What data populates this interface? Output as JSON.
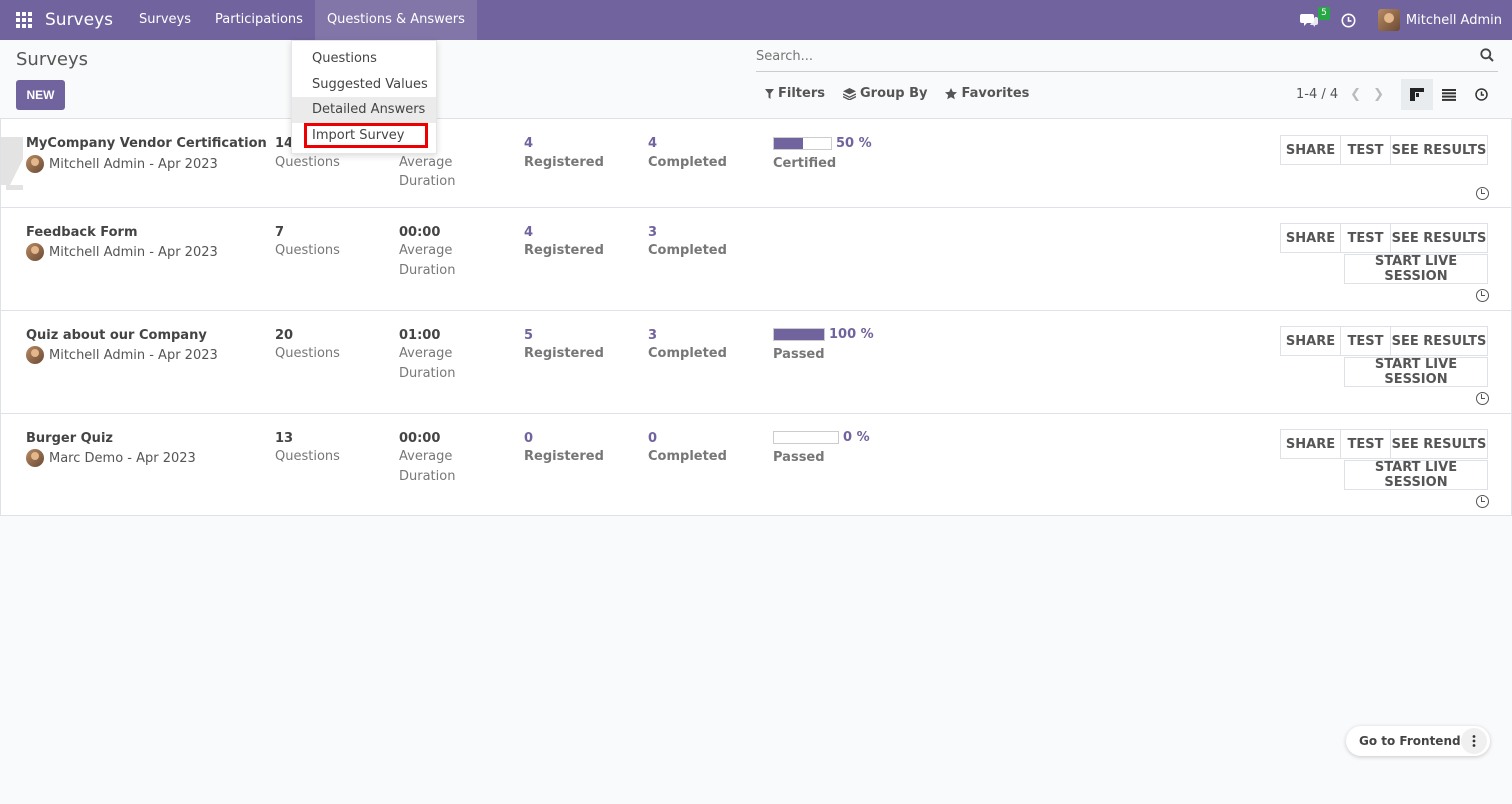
{
  "navbar": {
    "brand": "Surveys",
    "menu": [
      "Surveys",
      "Participations",
      "Questions & Answers"
    ],
    "messages_count": "5",
    "user_name": "Mitchell Admin",
    "color": "#71639e"
  },
  "dropdown": {
    "items": [
      "Questions",
      "Suggested Values",
      "Detailed Answers",
      "Import Survey"
    ]
  },
  "control": {
    "title": "Surveys",
    "new_label": "NEW",
    "search_placeholder": "Search...",
    "filters_label": "Filters",
    "groupby_label": "Group By",
    "favorites_label": "Favorites",
    "pager": "1-4 / 4"
  },
  "surveys": [
    {
      "name": "MyCompany Vendor Certification",
      "owner": "Mitchell Admin - Apr 2023",
      "questions": "14",
      "questions_label": "Questions",
      "duration": "",
      "duration_label_1": "Average",
      "duration_label_2": "Duration",
      "registered": "4",
      "registered_label": "Registered",
      "completed": "4",
      "completed_label": "Completed",
      "progress_percent": 50,
      "progress_text": "50 %",
      "result_label": "Certified",
      "buttons": [
        "SHARE",
        "TEST",
        "SEE RESULTS"
      ]
    },
    {
      "name": "Feedback Form",
      "owner": "Mitchell Admin - Apr 2023",
      "questions": "7",
      "questions_label": "Questions",
      "duration": "00:00",
      "duration_label_1": "Average",
      "duration_label_2": "Duration",
      "registered": "4",
      "registered_label": "Registered",
      "completed": "3",
      "completed_label": "Completed",
      "buttons": [
        "SHARE",
        "TEST",
        "SEE RESULTS"
      ],
      "live_label": "START LIVE SESSION"
    },
    {
      "name": "Quiz about our Company",
      "owner": "Mitchell Admin - Apr 2023",
      "questions": "20",
      "questions_label": "Questions",
      "duration": "01:00",
      "duration_label_1": "Average",
      "duration_label_2": "Duration",
      "registered": "5",
      "registered_label": "Registered",
      "completed": "3",
      "completed_label": "Completed",
      "progress_percent": 100,
      "progress_text": "100 %",
      "result_label": "Passed",
      "buttons": [
        "SHARE",
        "TEST",
        "SEE RESULTS"
      ],
      "live_label": "START LIVE SESSION"
    },
    {
      "name": "Burger Quiz",
      "owner": "Marc Demo - Apr 2023",
      "questions": "13",
      "questions_label": "Questions",
      "duration": "00:00",
      "duration_label_1": "Average",
      "duration_label_2": "Duration",
      "registered": "0",
      "registered_label": "Registered",
      "completed": "0",
      "completed_label": "Completed",
      "progress_percent": 0,
      "progress_text": "0 %",
      "result_label": "Passed",
      "buttons": [
        "SHARE",
        "TEST",
        "SEE RESULTS"
      ],
      "live_label": "START LIVE SESSION"
    }
  ],
  "frontend_label": "Go to Frontend"
}
